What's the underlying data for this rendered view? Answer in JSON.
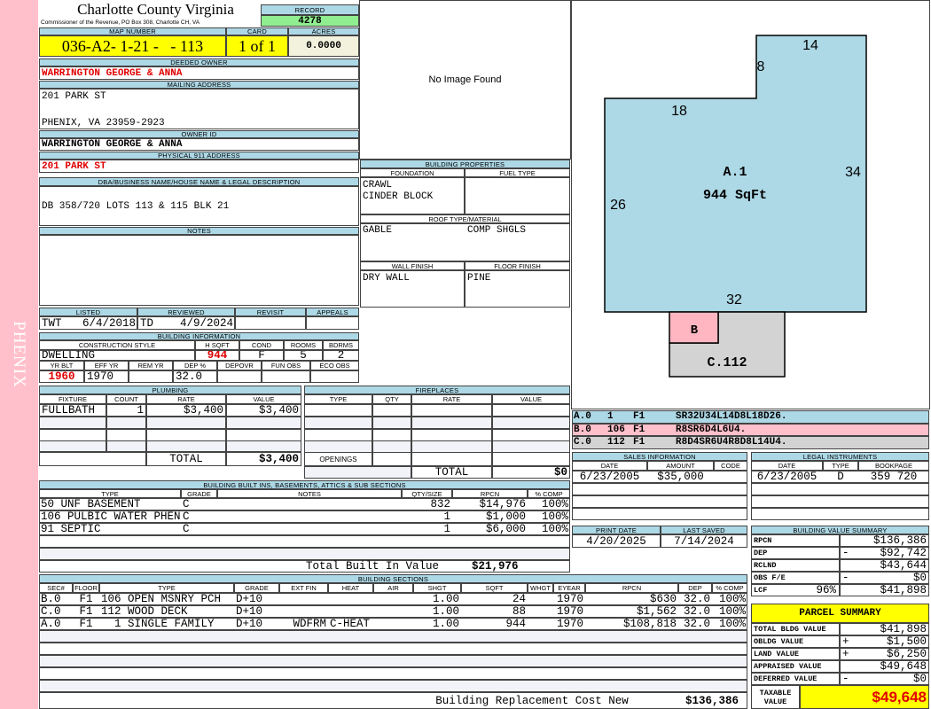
{
  "side_label": "PHENIX",
  "header": {
    "county": "Charlotte County Virginia",
    "subtitle": "Commissioner of the Revenue, PO Box 308, Charlotte CH, VA",
    "record": "4278"
  },
  "labels": {
    "record": "RECORD",
    "map_number": "MAP NUMBER",
    "card": "CARD",
    "acres": "ACRES",
    "deeded_owner": "DEEDED OWNER",
    "mailing_address": "MAILING ADDRESS",
    "owner_id": "OWNER ID",
    "physical_address": "PHYSICAL 911 ADDRESS",
    "dba": "DBA/BUSINESS NAME/HOUSE NAME & LEGAL DESCRIPTION",
    "notes": "NOTES",
    "listed": "LISTED",
    "reviewed": "REVIEWED",
    "revisit": "REVISIT",
    "appeals": "APPEALS",
    "building_information": "BUILDING INFORMATION",
    "construction_style": "CONSTRUCTION STYLE",
    "hsqft": "H SQFT",
    "cond": "COND",
    "rooms": "ROOMS",
    "bdrms": "BDRMS",
    "yr_blt": "YR BLT",
    "eff_yr": "EFF YR",
    "rem_yr": "REM YR",
    "dep_pct": "DEP %",
    "depovr": "DEPOVR",
    "fun_obs": "FUN OBS",
    "eco_obs": "ECO OBS",
    "building_properties": "BUILDING PROPERTIES",
    "foundation": "FOUNDATION",
    "fuel_type": "FUEL TYPE",
    "roof": "ROOF TYPE/MATERIAL",
    "wall_finish": "WALL FINISH",
    "floor_finish": "FLOOR FINISH",
    "print_date": "PRINT DATE",
    "last_saved": "LAST SAVED"
  },
  "parcel": {
    "map_number": "036-A2- 1-21 -   - 113",
    "card": "1 of 1",
    "acres": "0.0000"
  },
  "owner": {
    "deeded_owner": "WARRINGTON GEORGE & ANNA",
    "mailing_address": [
      "201 PARK ST",
      "PHENIX, VA 23959-2923"
    ],
    "owner_id": "WARRINGTON GEORGE & ANNA",
    "physical_address": "201 PARK ST"
  },
  "dba": "DB 358/720 LOTS 113 & 115 BLK 21",
  "notes": "",
  "image": {
    "placeholder": "No Image Found"
  },
  "review": {
    "listed_by": "TWT",
    "listed_date": "6/4/2018",
    "reviewed_by": "TD",
    "reviewed_date": "4/9/2024",
    "revisit": "",
    "appeals": ""
  },
  "building_info": {
    "construction_style": "DWELLING",
    "hsqft": "944",
    "cond": "F",
    "rooms": "5",
    "bdrms": "2",
    "yr_blt": "1960",
    "eff_yr": "1970",
    "rem_yr": "",
    "dep_pct": "32.0",
    "depovr": "",
    "fun_obs": "",
    "eco_obs": ""
  },
  "plumbing": {
    "title": "PLUMBING",
    "columns": [
      "FIXTURE",
      "COUNT",
      "RATE",
      "VALUE"
    ],
    "rows": [
      [
        "FULLBATH",
        "1",
        "$3,400",
        "$3,400"
      ]
    ],
    "total_label": "TOTAL",
    "total": "$3,400"
  },
  "fireplaces": {
    "title": "FIREPLACES",
    "columns": [
      "TYPE",
      "QTY",
      "RATE",
      "VALUE"
    ],
    "rows": [],
    "openings_label": "OPENINGS",
    "total_label": "TOTAL",
    "total": "$0"
  },
  "building_properties": {
    "foundation": [
      "CRAWL",
      "CINDER BLOCK"
    ],
    "fuel_type": "",
    "roof_type": "GABLE",
    "roof_material": "COMP SHGLS",
    "wall_finish": "DRY WALL",
    "floor_finish": "PINE"
  },
  "sketch": {
    "main_label": "A.1",
    "main_area": "944 SqFt",
    "porch_label": "B",
    "deck_label": "C.112",
    "dimensions": [
      "14",
      "8",
      "18",
      "34",
      "26",
      "32"
    ],
    "colors": {
      "main": "#add8e6",
      "porch": "#ffb6c1",
      "deck": "#d3d3d3"
    },
    "lines": [
      {
        "sec": "A.0",
        "code": "1",
        "floor": "F1",
        "vectors": "SR32U34L14D8L18D26.",
        "color": "#add8e6"
      },
      {
        "sec": "B.0",
        "code": "106",
        "floor": "F1",
        "vectors": "R8SR6D4L6U4.",
        "color": "#ffc0cb"
      },
      {
        "sec": "C.0",
        "code": "112",
        "floor": "F1",
        "vectors": "R8D4SR6U4R8D8L14U4.",
        "color": "#d3d3d3"
      }
    ]
  },
  "sales": {
    "title": "SALES INFORMATION",
    "columns": [
      "DATE",
      "AMOUNT",
      "CODE"
    ],
    "rows": [
      [
        "6/23/2005",
        "$35,000",
        ""
      ]
    ]
  },
  "legal": {
    "title": "LEGAL INSTRUMENTS",
    "columns": [
      "DATE",
      "TYPE",
      "BOOKPAGE"
    ],
    "rows": [
      [
        "6/23/2005",
        "D",
        "359 720"
      ]
    ]
  },
  "dates": {
    "print_date": "4/20/2025",
    "last_saved": "7/14/2024"
  },
  "value_summary": {
    "title": "BUILDING VALUE SUMMARY",
    "rows": [
      {
        "label": "RPCN",
        "extra": "",
        "sign": "",
        "value": "$136,386"
      },
      {
        "label": "DEP",
        "extra": "",
        "sign": "-",
        "value": "$92,742"
      },
      {
        "label": "RCLND",
        "extra": "",
        "sign": "",
        "value": "$43,644"
      },
      {
        "label": "OBS F/E",
        "extra": "",
        "sign": "-",
        "value": "$0"
      },
      {
        "label": "LCF",
        "extra": "96%",
        "sign": "",
        "value": "$41,898"
      }
    ]
  },
  "parcel_summary": {
    "title": "PARCEL SUMMARY",
    "rows": [
      {
        "label": "TOTAL BLDG VALUE",
        "sign": "",
        "value": "$41,898"
      },
      {
        "label": "OBLDG VALUE",
        "sign": "+",
        "value": "$1,500"
      },
      {
        "label": "LAND VALUE",
        "sign": "+",
        "value": "$6,250"
      },
      {
        "label": "APPRAISED VALUE",
        "sign": "",
        "value": "$49,648"
      },
      {
        "label": "DEFERRED VALUE",
        "sign": "-",
        "value": "$0"
      }
    ],
    "taxable_label": "TAXABLE\nVALUE",
    "taxable_value": "$49,648"
  },
  "built_ins": {
    "title": "BUILDING BUILT INS, BASEMENTS, ATTICS & SUB SECTIONS",
    "columns": [
      "TYPE",
      "GRADE",
      "NOTES",
      "QTY/SIZE",
      "RPCN",
      "% COMP"
    ],
    "rows": [
      [
        "50 UNF BASEMENT",
        "C",
        "",
        "832",
        "$14,976",
        "100%"
      ],
      [
        "106 PULBIC WATER PHENIX",
        "C",
        "",
        "1",
        "$1,000",
        "100%"
      ],
      [
        "91 SEPTIC",
        "C",
        "",
        "1",
        "$6,000",
        "100%"
      ]
    ],
    "total_label": "Total Built In Value",
    "total": "$21,976"
  },
  "sections": {
    "title": "BUILDING SECTIONS",
    "columns": [
      "SEC#",
      "FLOOR",
      "TYPE",
      "GRADE",
      "EXT FIN",
      "HEAT",
      "AIR",
      "SHGT",
      "SQFT",
      "WHGT",
      "EYEAR",
      "RPCN",
      "DEP",
      "% COMP"
    ],
    "rows": [
      [
        "B.0",
        "F1",
        "106 OPEN MSNRY PCH",
        "D+10",
        "",
        "",
        "",
        "1.00",
        "24",
        "",
        "1970",
        "$630",
        "32.0",
        "100%"
      ],
      [
        "C.0",
        "F1",
        "112 WOOD DECK",
        "D+10",
        "",
        "",
        "",
        "1.00",
        "88",
        "",
        "1970",
        "$1,562",
        "32.0",
        "100%"
      ],
      [
        "A.0",
        "F1",
        "  1 SINGLE FAMILY",
        "D+10",
        "WDFRM",
        "C-HEAT",
        "",
        "1.00",
        "944",
        "",
        "1970",
        "$108,818",
        "32.0",
        "100%"
      ]
    ],
    "total_label": "Building Replacement Cost New",
    "total": "$136,386"
  }
}
